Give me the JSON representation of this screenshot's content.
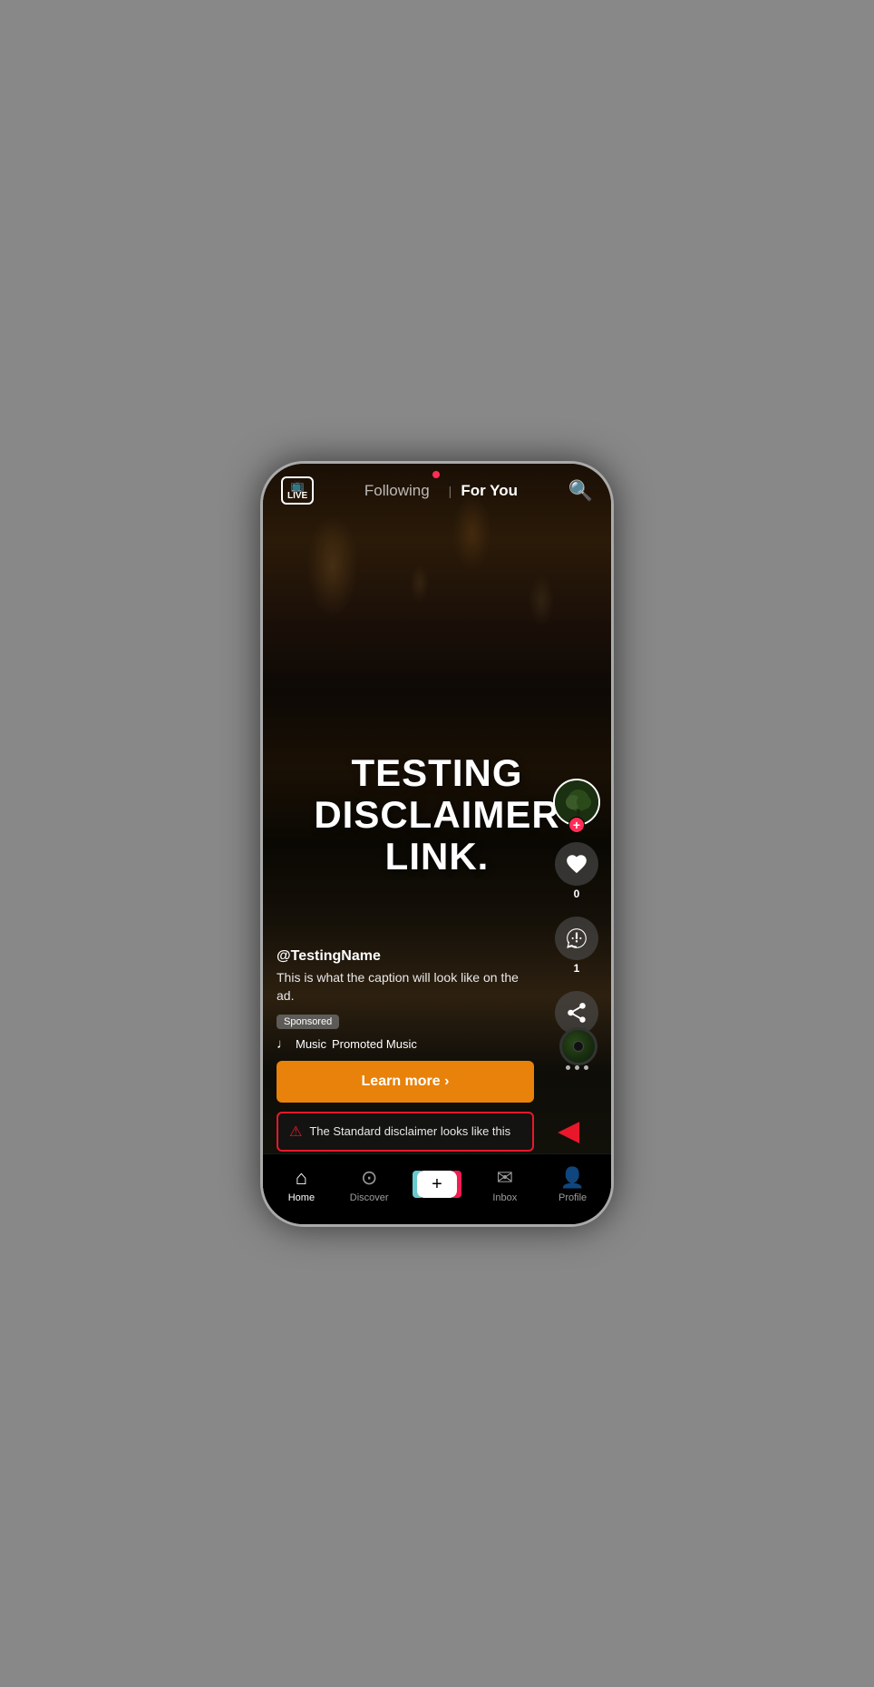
{
  "phone": {
    "topNav": {
      "live_label": "LIVE",
      "following_label": "Following",
      "foryou_label": "For You",
      "search_icon": "search-icon"
    },
    "video": {
      "title_line1": "TESTING",
      "title_line2": "DISCLAIMER",
      "title_line3": "LINK."
    },
    "sidebar": {
      "like_count": "0",
      "comment_count": "1",
      "share_label": "Share"
    },
    "content": {
      "username": "@TestingName",
      "caption": "This is what the caption will look like on the ad.",
      "sponsored_label": "Sponsored",
      "music_prefix": "♩ Music",
      "music_name": "Promoted Music",
      "learn_more_label": "Learn more  ›",
      "disclaimer_text": "The Standard disclaimer looks like this"
    },
    "bottomNav": {
      "home_label": "Home",
      "discover_label": "Discover",
      "add_label": "+",
      "inbox_label": "Inbox",
      "profile_label": "Profile"
    }
  }
}
